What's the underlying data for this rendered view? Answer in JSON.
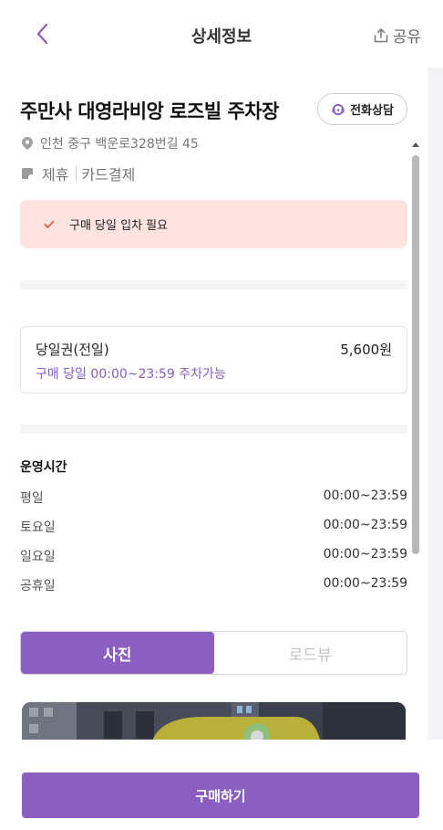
{
  "header": {
    "title": "상세정보",
    "share_label": "공유",
    "back_icon": "chevron-left-icon",
    "share_icon": "share-icon"
  },
  "place": {
    "name": "주만사 대영라비앙 로즈빌 주차장",
    "phone_button_label": "전화상담",
    "address": "인천 중구 백운로328번길 45",
    "tags": [
      "제휴",
      "카드결제"
    ]
  },
  "notice": {
    "text": "구매 당일 입차 필요"
  },
  "ticket": {
    "name": "당일권(전일)",
    "price": "5,600원",
    "description": "구매 당일 00:00~23:59 주차가능"
  },
  "hours": {
    "title": "운영시간",
    "rows": [
      {
        "day": "평일",
        "time": "00:00~23:59"
      },
      {
        "day": "토요일",
        "time": "00:00~23:59"
      },
      {
        "day": "일요일",
        "time": "00:00~23:59"
      },
      {
        "day": "공휴일",
        "time": "00:00~23:59"
      }
    ]
  },
  "tabs": {
    "photo_label": "사진",
    "roadview_label": "로드뷰",
    "active": "photo"
  },
  "bottom": {
    "buy_label": "구매하기"
  },
  "colors": {
    "accent": "#8b5fbf",
    "notice_bg": "#fde4e0",
    "notice_check": "#e1503c"
  }
}
